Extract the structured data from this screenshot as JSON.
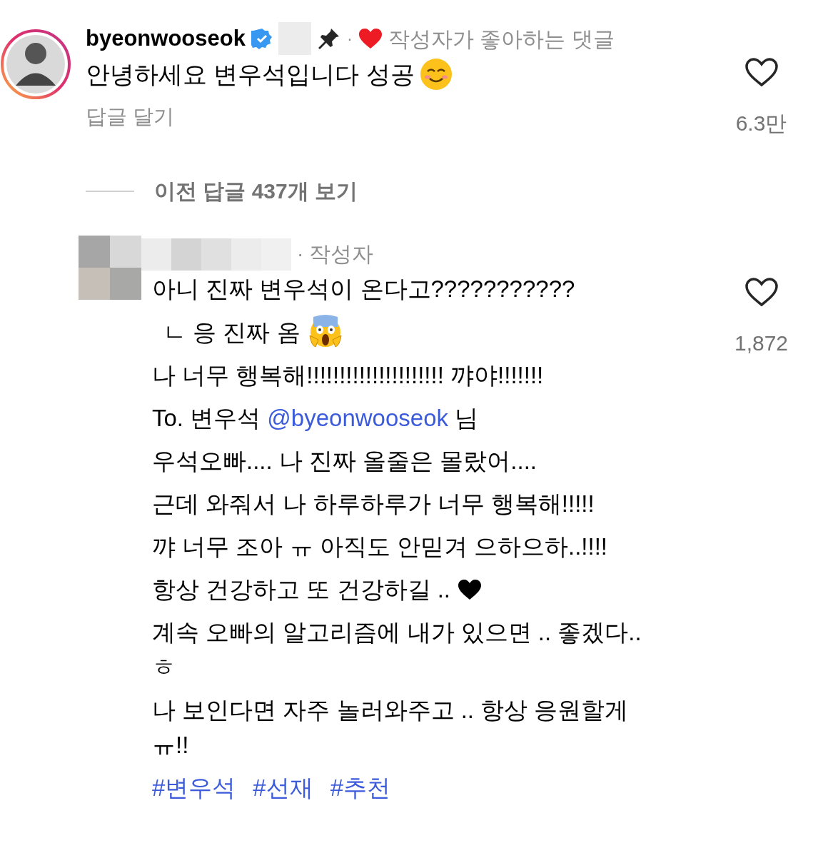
{
  "comment": {
    "username": "byeonwooseok",
    "verified": true,
    "pinned": true,
    "liked_by_author": true,
    "liked_label": "작성자가 좋아하는 댓글",
    "separator": "·",
    "text": "안녕하세요 변우석입니다 성공",
    "trailing_icon": {
      "kind": "smile"
    },
    "reply_label": "답글 달기",
    "like_count": "6.3만",
    "liked": false
  },
  "view_replies": {
    "label": "이전 답글 437개 보기"
  },
  "reply": {
    "author_label": "작성자",
    "separator": "·",
    "like_count": "1,872",
    "liked": false,
    "lines": [
      {
        "kind": "text",
        "text": "아니 진짜 변우석이 온다고???????????"
      },
      {
        "kind": "text",
        "text": "ㄴ 응 진짜 옴",
        "indent": true,
        "trailing_icon": {
          "kind": "scream"
        }
      },
      {
        "kind": "text",
        "text": "나 너무 행복해!!!!!!!!!!!!!!!!!!!!! 꺄야!!!!!!!"
      },
      {
        "kind": "mention",
        "before": "To. 변우석",
        "mention": "@byeonwooseok",
        "after": "님"
      },
      {
        "kind": "text",
        "text": "우석오빠.... 나 진짜 올줄은 몰랐어...."
      },
      {
        "kind": "text",
        "text": "근데 와줘서 나 하루하루가 너무 행복해!!!!!"
      },
      {
        "kind": "text",
        "text": "꺄 너무 조아 ㅠ 아직도 안믿겨 으하으하..!!!!"
      },
      {
        "kind": "text",
        "text": "항상 건강하고 또 건강하길 ..",
        "trailing_icon": {
          "kind": "heart"
        }
      },
      {
        "kind": "text",
        "text": "계속 오빠의 알고리즘에 내가 있으면 .. 좋겠다..ㅎ"
      },
      {
        "kind": "text",
        "text": "나 보인다면 자주 놀러와주고 .. 항상 응원할게 ㅠ!!"
      },
      {
        "kind": "hashtags",
        "tags": [
          "#변우석",
          "#선재",
          "#추천"
        ]
      }
    ]
  }
}
